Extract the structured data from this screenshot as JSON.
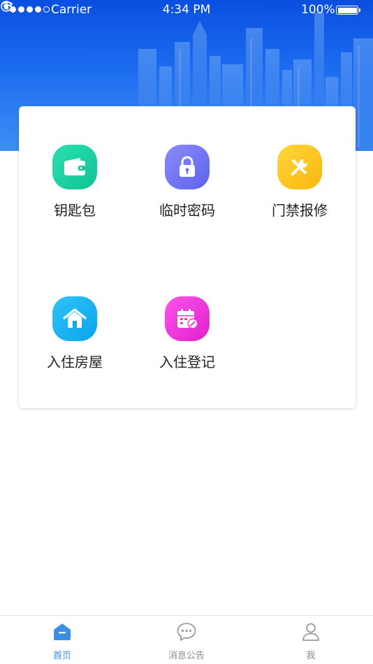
{
  "status_bar": {
    "carrier": "Carrier",
    "time": "4:34 PM",
    "battery": "100%"
  },
  "menu": {
    "items": [
      {
        "label": "钥匙包",
        "icon": "wallet-icon",
        "color": "#1fd0a6"
      },
      {
        "label": "临时密码",
        "icon": "lock-icon",
        "color": "#7478f4"
      },
      {
        "label": "门禁报修",
        "icon": "tools-icon",
        "color": "#fcc21f"
      },
      {
        "label": "入住房屋",
        "icon": "home-icon",
        "color": "#16b2f2"
      },
      {
        "label": "入住登记",
        "icon": "calendar-edit-icon",
        "color": "#f03ddc"
      }
    ]
  },
  "tabbar": {
    "tabs": [
      {
        "label": "首页",
        "icon": "home-tab-icon",
        "active": true
      },
      {
        "label": "消息公告",
        "icon": "message-icon",
        "active": false
      },
      {
        "label": "我",
        "icon": "user-icon",
        "active": false
      }
    ],
    "active_color": "#3a8ee6",
    "inactive_color": "#8c8c8c"
  }
}
